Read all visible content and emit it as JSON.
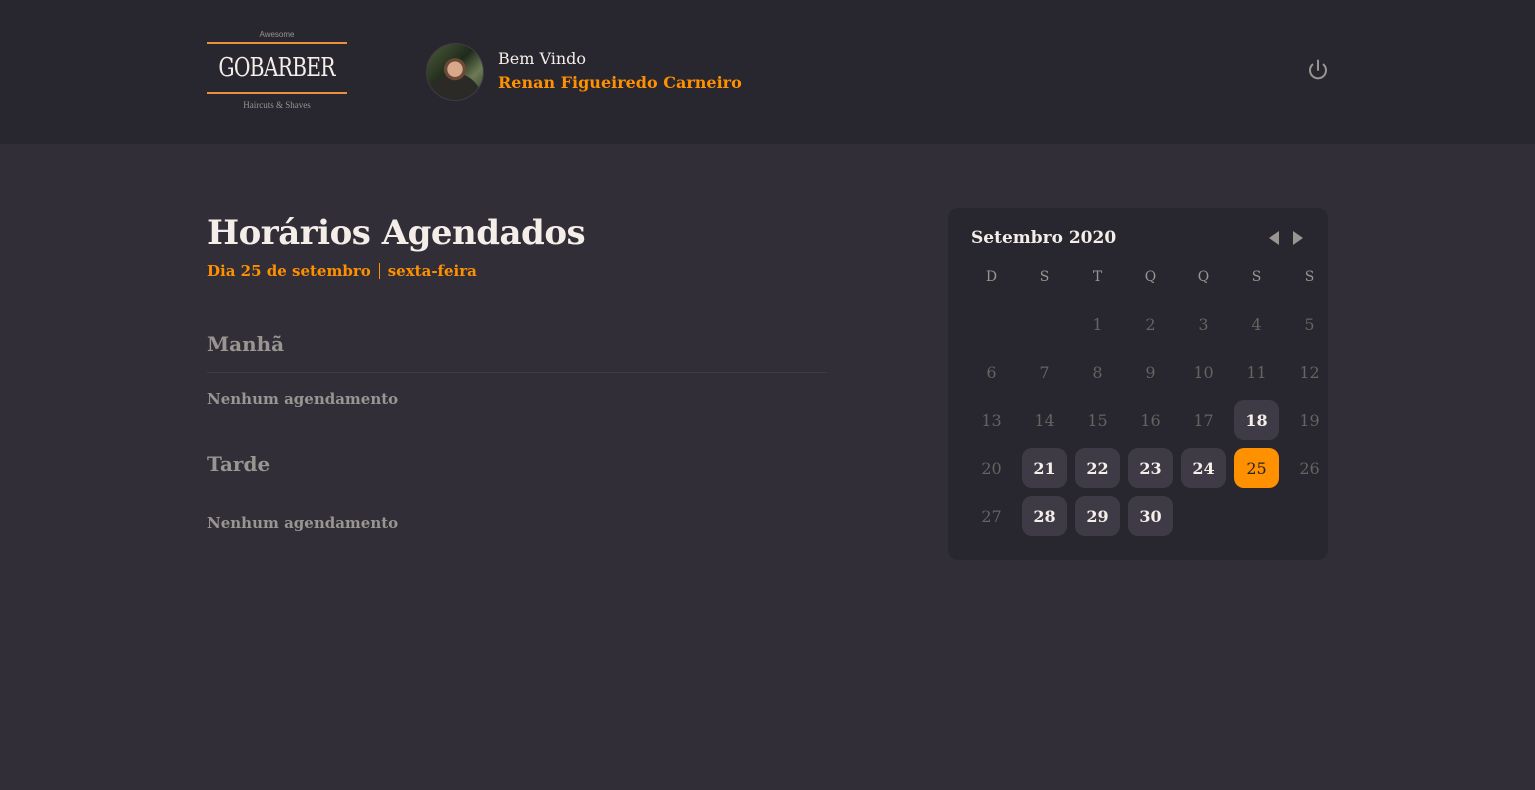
{
  "header": {
    "logo": {
      "top_text": "Awesome",
      "brand": "GOBARBER",
      "bottom_text": "Haircuts & Shaves"
    },
    "welcome": "Bem Vindo",
    "user_name": "Renan Figueiredo Carneiro",
    "logout_icon": "power-icon"
  },
  "main": {
    "title": "Horários Agendados",
    "day_label": "Dia 25 de setembro",
    "weekday_label": "sexta-feira",
    "morning": {
      "title": "Manhã",
      "empty": "Nenhum agendamento"
    },
    "afternoon": {
      "title": "Tarde",
      "empty": "Nenhum agendamento"
    }
  },
  "calendar": {
    "month": "Setembro 2020",
    "prev_icon": "chevron-left-icon",
    "next_icon": "chevron-right-icon",
    "weekdays": [
      "D",
      "S",
      "T",
      "Q",
      "Q",
      "S",
      "S"
    ],
    "days": [
      {
        "label": "",
        "state": "blank"
      },
      {
        "label": "",
        "state": "blank"
      },
      {
        "label": "1",
        "state": "disabled"
      },
      {
        "label": "2",
        "state": "disabled"
      },
      {
        "label": "3",
        "state": "disabled"
      },
      {
        "label": "4",
        "state": "disabled"
      },
      {
        "label": "5",
        "state": "disabled"
      },
      {
        "label": "6",
        "state": "disabled"
      },
      {
        "label": "7",
        "state": "disabled"
      },
      {
        "label": "8",
        "state": "disabled"
      },
      {
        "label": "9",
        "state": "disabled"
      },
      {
        "label": "10",
        "state": "disabled"
      },
      {
        "label": "11",
        "state": "disabled"
      },
      {
        "label": "12",
        "state": "disabled"
      },
      {
        "label": "13",
        "state": "disabled"
      },
      {
        "label": "14",
        "state": "disabled"
      },
      {
        "label": "15",
        "state": "disabled"
      },
      {
        "label": "16",
        "state": "disabled"
      },
      {
        "label": "17",
        "state": "disabled"
      },
      {
        "label": "18",
        "state": "available"
      },
      {
        "label": "19",
        "state": "disabled"
      },
      {
        "label": "20",
        "state": "disabled"
      },
      {
        "label": "21",
        "state": "available"
      },
      {
        "label": "22",
        "state": "available"
      },
      {
        "label": "23",
        "state": "available"
      },
      {
        "label": "24",
        "state": "available"
      },
      {
        "label": "25",
        "state": "selected"
      },
      {
        "label": "26",
        "state": "disabled"
      },
      {
        "label": "27",
        "state": "disabled"
      },
      {
        "label": "28",
        "state": "available"
      },
      {
        "label": "29",
        "state": "available"
      },
      {
        "label": "30",
        "state": "available"
      }
    ]
  },
  "colors": {
    "accent": "#ff9000",
    "background": "#312e38",
    "header_bg": "#28262e",
    "available_day": "#3e3b47",
    "muted_text": "#999591"
  }
}
